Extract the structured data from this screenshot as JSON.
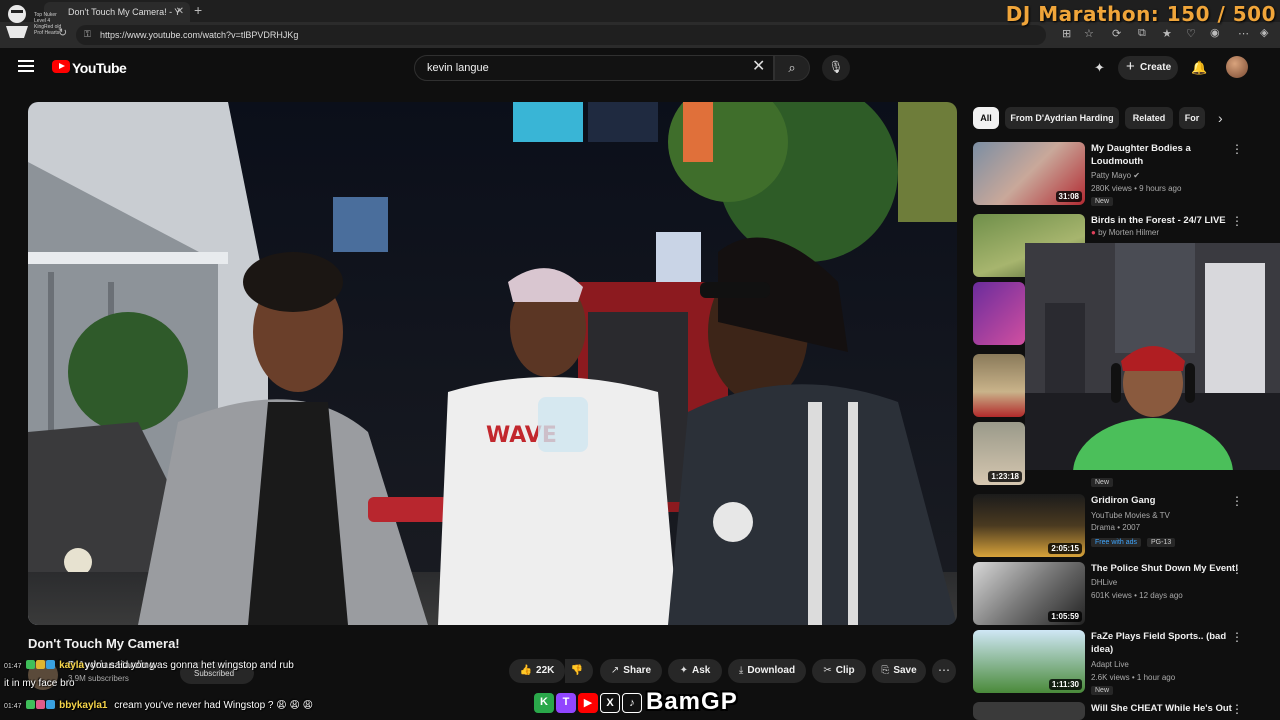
{
  "browser": {
    "tab_title": "Don't Touch My Camera! - Y",
    "url": "https://www.youtube.com/watch?v=tlBPVDRHJKg"
  },
  "overlay": {
    "marathon_label": "DJ Marathon: 150 / 500",
    "logo_lines": [
      "Top Nuker",
      "Level 4",
      "KingRed old",
      "Prof Hearts"
    ]
  },
  "header": {
    "logo_text": "YouTube",
    "search_value": "kevin langue",
    "create_label": "Create"
  },
  "video": {
    "title": "Don't Touch My Camera!",
    "channel": "D'Aydrian Harding",
    "subscribers": "3.9M subscribers",
    "subscribe_label": "Subscribed",
    "likes": "22K",
    "actions": [
      "Share",
      "Ask",
      "Download",
      "Clip",
      "Save"
    ]
  },
  "chat": [
    {
      "time": "01:47",
      "user": "kayla",
      "text": "you said you was gonna het wingstop and rub",
      "cont": "it in my face bro"
    },
    {
      "time": "01:47",
      "user": "bbykayla1",
      "text": "cream you've never had Wingstop ? 😩 😩 😩"
    }
  ],
  "social": {
    "handle": "BamGP",
    "icons": [
      "K",
      "T",
      "▶",
      "X",
      "♪"
    ]
  },
  "sidebar": {
    "chips": [
      "All",
      "From D'Aydrian Harding",
      "Related",
      "For"
    ],
    "recs": [
      {
        "title": "My Daughter Bodies a Loudmouth",
        "channel": "Patty Mayo",
        "meta": "280K views • 9 hours ago",
        "badge": "New",
        "duration": "31:08"
      },
      {
        "title": "Birds in the Forest - 24/7 LIVE",
        "channel": "by Morten Hilmer",
        "meta": "",
        "badge": "",
        "duration": ""
      },
      {
        "title": "",
        "channel": "",
        "meta": "",
        "badge": "New",
        "duration": "1:23:18"
      },
      {
        "title": "Gridiron Gang",
        "channel": "YouTube Movies & TV",
        "meta": "Drama • 2007",
        "badge": "Free with ads",
        "badge2": "PG-13",
        "duration": "2:05:15"
      },
      {
        "title": "The Police Shut Down My Event!",
        "channel": "DHLive",
        "meta": "601K views • 12 days ago",
        "badge": "",
        "duration": "1:05:59"
      },
      {
        "title": "FaZe Plays Field Sports.. (bad idea)",
        "channel": "Adapt Live",
        "meta": "2.6K views • 1 hour ago",
        "badge": "New",
        "duration": "1:11:30"
      },
      {
        "title": "Will She CHEAT While He's Out",
        "channel": "",
        "meta": "",
        "badge": "",
        "duration": ""
      }
    ]
  },
  "colors": {
    "background": "#0f0f0f",
    "accent_red": "#ff0000",
    "marathon_orange": "#f0a53a",
    "chat_user": "#f6d54a"
  }
}
